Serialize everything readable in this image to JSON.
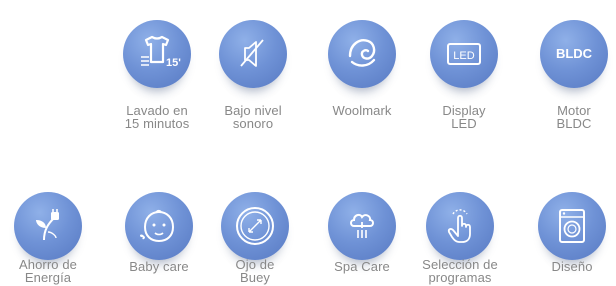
{
  "features": [
    {
      "label": "Lavado en\n15 minutos",
      "icon": "shirt-15-minutes-icon"
    },
    {
      "label": "Bajo nivel\nsonoro",
      "icon": "muted-speaker-icon"
    },
    {
      "label": "Woolmark",
      "icon": "woolmark-icon"
    },
    {
      "label": "Display\nLED",
      "icon": "led-display-icon",
      "icon_text": "LED"
    },
    {
      "label": "Motor\nBLDC",
      "icon": "bldc-motor-icon",
      "icon_text": "BLDC"
    },
    {
      "label": "Ahorro de\nEnergía",
      "icon": "energy-plug-plant-icon"
    },
    {
      "label": "Baby care",
      "icon": "baby-face-icon"
    },
    {
      "label": "Ojo de\nBuey",
      "icon": "porthole-door-icon"
    },
    {
      "label": "Spa Care",
      "icon": "spa-cloud-icon"
    },
    {
      "label": "Selección de\nprogramas",
      "icon": "touch-select-icon"
    },
    {
      "label": "Diseño",
      "icon": "washing-machine-icon"
    }
  ],
  "colors": {
    "icon_circle": "#6f92d6",
    "icon_glyph": "#ffffff",
    "label_text": "#888888"
  }
}
